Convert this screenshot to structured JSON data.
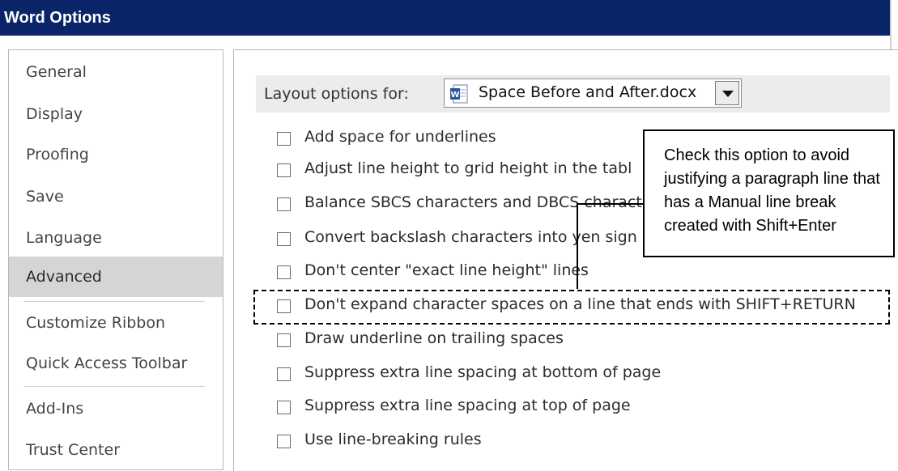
{
  "window": {
    "title": "Word Options"
  },
  "sidebar": {
    "items": [
      {
        "label": "General"
      },
      {
        "label": "Display"
      },
      {
        "label": "Proofing"
      },
      {
        "label": "Save"
      },
      {
        "label": "Language"
      },
      {
        "label": "Advanced",
        "selected": true
      },
      {
        "label": "Customize Ribbon"
      },
      {
        "label": "Quick Access Toolbar"
      },
      {
        "label": "Add-Ins"
      },
      {
        "label": "Trust Center"
      }
    ]
  },
  "layout_options": {
    "label": "Layout options for:",
    "document": "Space Before and After.docx",
    "document_icon": "word-doc-icon"
  },
  "options": [
    {
      "label": "Add space for underlines",
      "checked": false
    },
    {
      "label": "Adjust line height to grid height in the tabl",
      "checked": false
    },
    {
      "label": "Balance SBCS characters and DBCS charact",
      "checked": false
    },
    {
      "label": "Convert backslash characters into yen sign",
      "checked": false
    },
    {
      "label": "Don't center \"exact line height\" lines",
      "checked": false
    },
    {
      "label": "Don't expand character spaces on a line that ends with SHIFT+RETURN",
      "checked": false,
      "highlighted": true
    },
    {
      "label": "Draw underline on trailing spaces",
      "checked": false
    },
    {
      "label": "Suppress extra line spacing at bottom of page",
      "checked": false
    },
    {
      "label": "Suppress extra line spacing at top of page",
      "checked": false
    },
    {
      "label": "Use line-breaking rules",
      "checked": false
    }
  ],
  "callout": {
    "lines": [
      "Check this option to avoid",
      "justifying a paragraph line that",
      "has a Manual line break",
      "created with Shift+Enter"
    ]
  },
  "colors": {
    "title_bar": "#0a246a",
    "selected_nav": "#d5d5d5",
    "layout_bar": "#ececec"
  }
}
